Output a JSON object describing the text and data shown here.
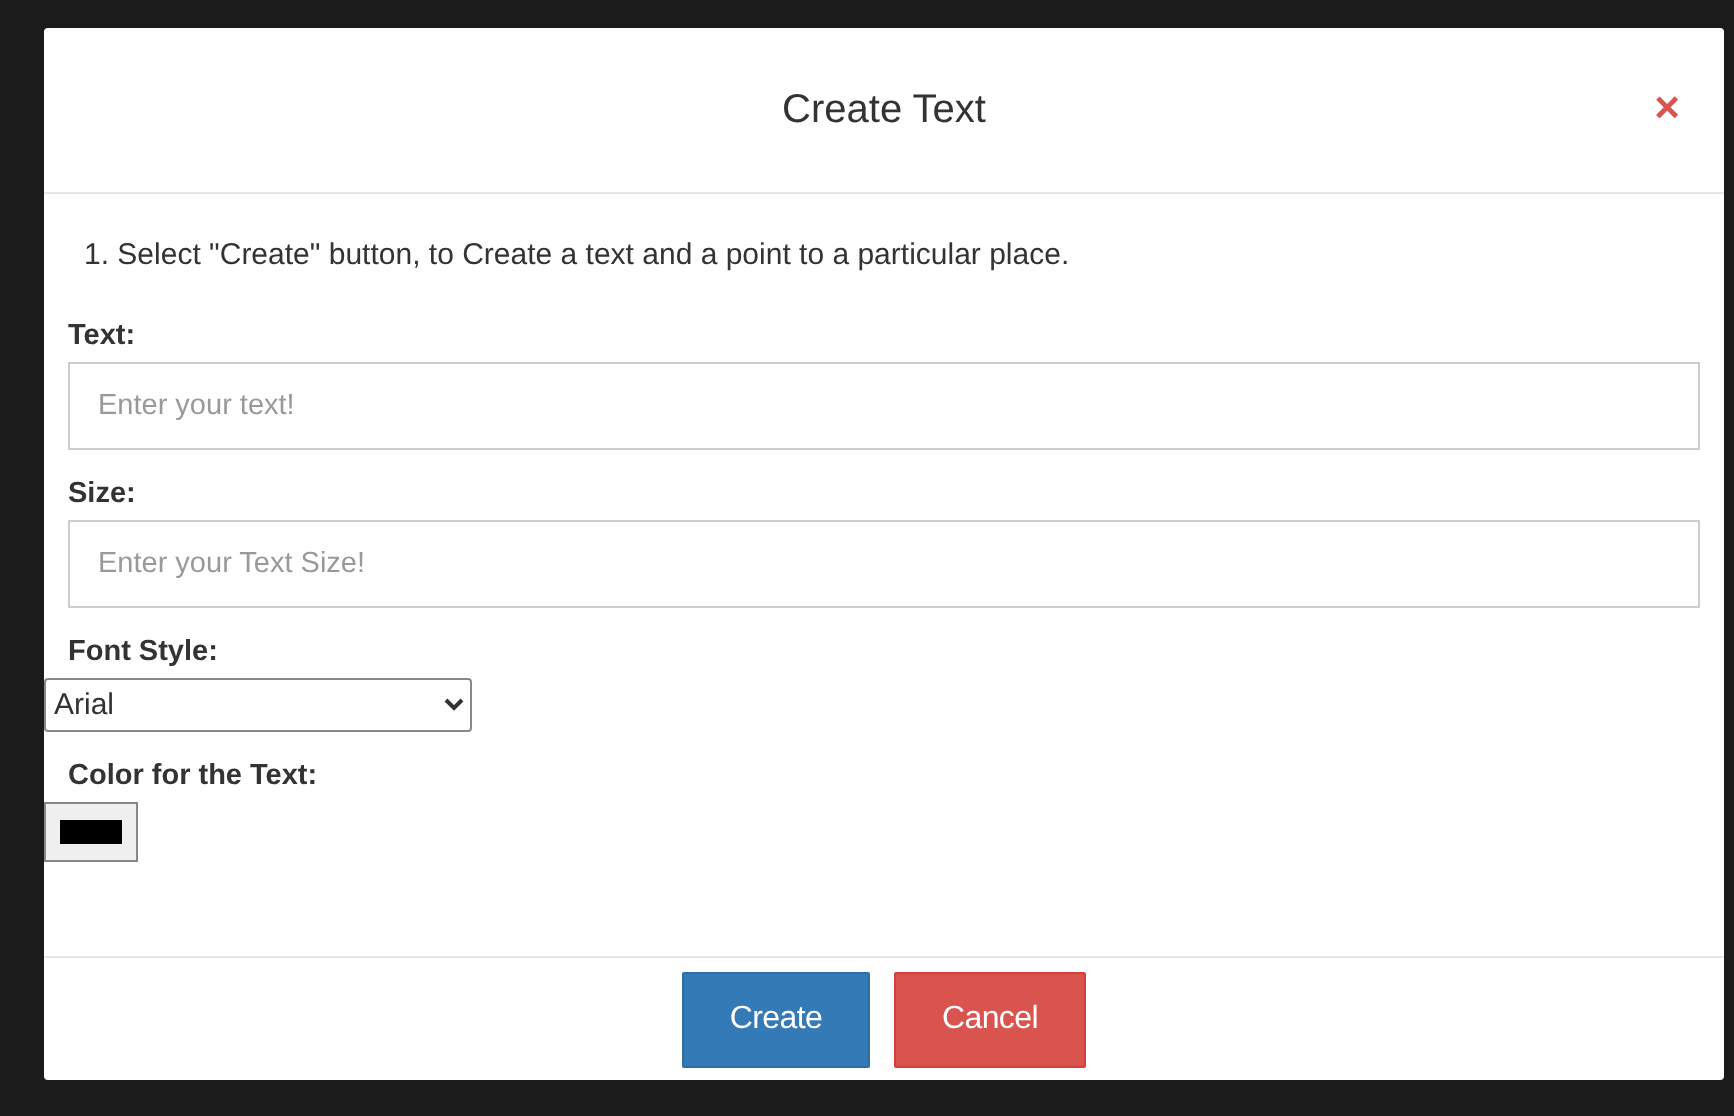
{
  "dialog": {
    "title": "Create Text",
    "close": "×",
    "instruction": "1. Select \"Create\" button, to Create a text and a point to a particular place.",
    "fields": [
      {
        "kind": "text",
        "label": "Text:",
        "placeholder": "Enter your text!"
      },
      {
        "kind": "text",
        "label": "Size:",
        "placeholder": "Enter your Text Size!"
      },
      {
        "kind": "select",
        "label": "Font Style:",
        "value": "Arial"
      },
      {
        "kind": "color",
        "label": "Color for the Text:",
        "color": "#000000"
      }
    ],
    "buttons": [
      {
        "label": "Create",
        "kind": "primary"
      },
      {
        "label": "Cancel",
        "kind": "danger"
      }
    ]
  }
}
